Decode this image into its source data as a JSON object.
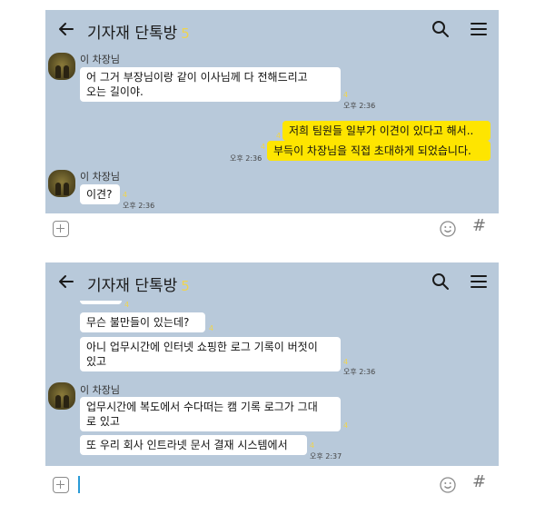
{
  "chat_screens": [
    {
      "header": {
        "title": "기자재 단톡방",
        "member_count": "5"
      },
      "messages": {
        "sender": "이 차장님",
        "m1_line1": "어 그거 부장님이랑 같이 이사님께 다 전해드리고",
        "m1_line2": "오는 길이야.",
        "m1_unread": "4",
        "m1_time": "오후 2:36",
        "m2": "저희 팀원들 일부가 이견이 있다고 해서..",
        "m2_unread": "4",
        "m3": "부득이 차장님을 직접 초대하게 되었습니다.",
        "m3_unread": "4",
        "m3_time": "오후 2:36",
        "m4_sender": "이 차장님",
        "m4": "이견?",
        "m4_unread": "4",
        "m4_time": "오후 2:36"
      }
    },
    {
      "header": {
        "title": "기자재 단톡방",
        "member_count": "5"
      },
      "messages": {
        "top_unread": "4",
        "m1": "무슨 불만들이 있는데?",
        "m1_unread": "4",
        "m2_line1": "아니 업무시간에 인터넷 쇼핑한 로그 기록이 버젓이",
        "m2_line2": "있고",
        "m2_unread": "4",
        "m2_time": "오후 2:36",
        "sender": "이 차장님",
        "m3_line1": "업무시간에 복도에서 수다떠는 캠 기록 로그가 그대",
        "m3_line2": "로 있고",
        "m3_unread": "4",
        "m4": "또 우리 회사 인트라넷 문서 결재 시스템에서",
        "m4_unread": "4",
        "m4_time": "오후 2:37"
      }
    }
  ],
  "icons": {
    "back": "arrow-left-icon",
    "search": "search-icon",
    "menu": "hamburger-menu-icon",
    "plus": "plus-square-icon",
    "emoji": "smiley-icon",
    "hash": "hash-icon"
  },
  "colors": {
    "chat_background": "#b8c9da",
    "my_bubble": "#fee500",
    "other_bubble": "#ffffff",
    "unread_count": "#efd44f",
    "input_caret": "#2a9ad6"
  }
}
